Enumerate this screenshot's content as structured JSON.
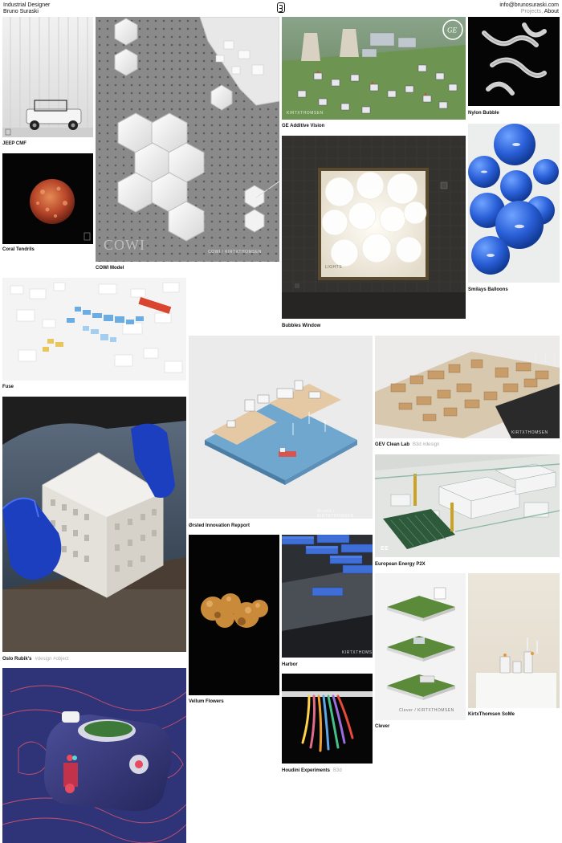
{
  "header": {
    "role": "Industrial Designer",
    "name": "Bruno Suraski",
    "email": "info@brunosuraski.com",
    "nav_projects": "Projects",
    "nav_sep": ", ",
    "nav_about": "About"
  },
  "projects": [
    {
      "title": "JEEP CMF",
      "tags": ""
    },
    {
      "title": "COWI Model",
      "tags": ""
    },
    {
      "title": "GE Additive Vision",
      "tags": ""
    },
    {
      "title": "Nylon Bubble",
      "tags": ""
    },
    {
      "title": "Coral Tendrils",
      "tags": ""
    },
    {
      "title": "Bubbles Window",
      "tags": ""
    },
    {
      "title": "Smilays Balloons",
      "tags": ""
    },
    {
      "title": "Fuse",
      "tags": ""
    },
    {
      "title": "Ørsted Innovation Repport",
      "tags": ""
    },
    {
      "title": "GEV Clean Lab",
      "tags": "B3d  #design"
    },
    {
      "title": "Oslo Rubik's",
      "tags": "#design  #object"
    },
    {
      "title": "European Energy P2X",
      "tags": ""
    },
    {
      "title": "Vellum Flowers",
      "tags": ""
    },
    {
      "title": "Harbor",
      "tags": ""
    },
    {
      "title": "Clever",
      "tags": ""
    },
    {
      "title": "KirtxThomsen SoMe",
      "tags": ""
    },
    {
      "title": "Houdini Experiments",
      "tags": "B3d"
    },
    {
      "title": "",
      "tags": ""
    }
  ],
  "watermarks": {
    "cowi": "COWI",
    "kt": "KIRTXTHOMSEN",
    "cowi_kt": "COWI / KIRTXTHOMSEN",
    "orsted": "Ørsted / KIRTXTHOMSEN",
    "clever": "Clever / KIRTXTHOMSEN",
    "ee": "EE",
    "lights": "LIGHTS"
  },
  "colors": {
    "background": "#ffffff",
    "text": "#111111",
    "muted": "#999999",
    "tag": "#aaaaaa"
  }
}
